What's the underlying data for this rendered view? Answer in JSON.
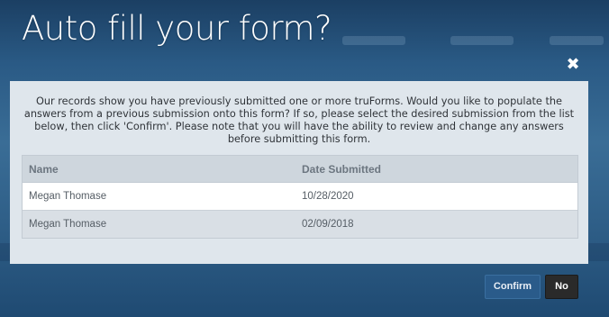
{
  "modal": {
    "title": "Auto fill your form?",
    "close_icon": "close-icon",
    "message": "Our records show you have previously submitted one or more truForms. Would you like to populate the answers from a previous submission onto this form? If so, please select the desired submission from the list below, then click 'Confirm'. Please note that you will have the ability to review and change any answers before submitting this form."
  },
  "table": {
    "columns": [
      "Name",
      "Date Submitted"
    ],
    "rows": [
      {
        "name": "Megan Thomase",
        "date": "10/28/2020",
        "selected": true
      },
      {
        "name": "Megan Thomase",
        "date": "02/09/2018",
        "selected": false
      }
    ]
  },
  "buttons": {
    "confirm": "Confirm",
    "no": "No"
  },
  "colors": {
    "confirm_bg": "#2a5b8a",
    "no_bg": "#2a2a2a"
  }
}
